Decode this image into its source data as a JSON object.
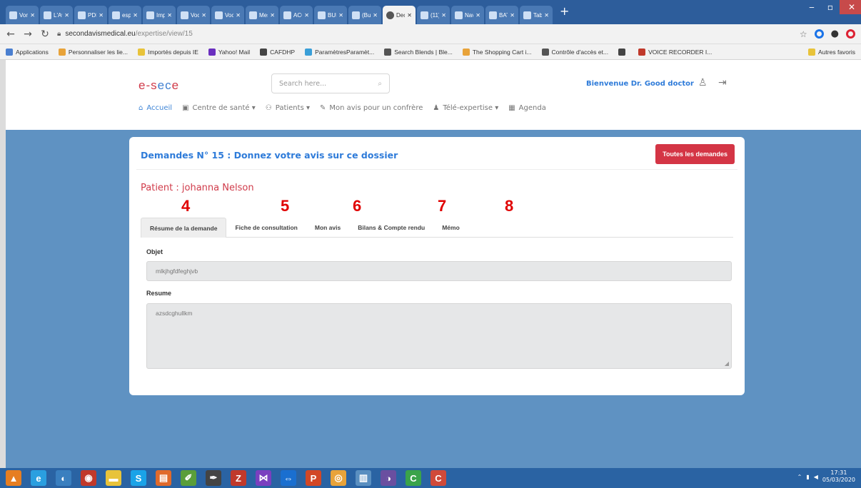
{
  "browser": {
    "tabs": [
      {
        "title": "Von",
        "active": false
      },
      {
        "title": "L'Av",
        "active": false
      },
      {
        "title": "PDF",
        "active": false
      },
      {
        "title": "esp",
        "active": false
      },
      {
        "title": "Imp",
        "active": false
      },
      {
        "title": "Voc",
        "active": false
      },
      {
        "title": "Voc",
        "active": false
      },
      {
        "title": "Mes",
        "active": false
      },
      {
        "title": "ACC",
        "active": false
      },
      {
        "title": "BUL",
        "active": false
      },
      {
        "title": "(Bu",
        "active": false
      },
      {
        "title": "Dec",
        "active": true
      },
      {
        "title": "(11)",
        "active": false
      },
      {
        "title": "Nav",
        "active": false
      },
      {
        "title": "BAT",
        "active": false
      },
      {
        "title": "Tabs",
        "active": false
      }
    ],
    "url_host": "secondavismedical.eu",
    "url_path": "/expertise/view/15",
    "bookmarks": [
      {
        "label": "Applications",
        "color": "#4a7fd0"
      },
      {
        "label": "Personnaliser les lie...",
        "color": "#e8a33a"
      },
      {
        "label": "Importés depuis IE",
        "color": "#e8c33a"
      },
      {
        "label": "Yahoo! Mail",
        "color": "#6a2fbf"
      },
      {
        "label": "CAFDHP",
        "color": "#444444"
      },
      {
        "label": "ParamètresParamèt...",
        "color": "#3a9fd8"
      },
      {
        "label": "Search Blends | Ble...",
        "color": "#555555"
      },
      {
        "label": "The Shopping Cart i...",
        "color": "#e8a33a"
      },
      {
        "label": "Contrôle d'accès et...",
        "color": "#555555"
      },
      {
        "label": "",
        "color": "#444444"
      },
      {
        "label": "VOICE RECORDER I...",
        "color": "#c0392b"
      }
    ],
    "other_bookmarks": "Autres favoris"
  },
  "site": {
    "logo_left": "e-s",
    "logo_mid": "ec",
    "logo_right": "e",
    "search_placeholder": "Search here...",
    "welcome": "Bienvenue Dr. Good doctor",
    "nav": [
      {
        "label": "Accueil",
        "icon": "home-icon",
        "glyph": "⌂",
        "active": true
      },
      {
        "label": "Centre de santé ▾",
        "icon": "building-icon",
        "glyph": "▣",
        "active": false
      },
      {
        "label": "Patients ▾",
        "icon": "users-icon",
        "glyph": "⚇",
        "active": false
      },
      {
        "label": "Mon avis pour un confrère",
        "icon": "edit-icon",
        "glyph": "✎",
        "active": false
      },
      {
        "label": "Télé-expertise ▾",
        "icon": "user-md-icon",
        "glyph": "♟",
        "active": false
      },
      {
        "label": "Agenda",
        "icon": "calendar-icon",
        "glyph": "▦",
        "active": false
      }
    ]
  },
  "card": {
    "title": "Demandes N° 15 : Donnez votre avis sur ce dossier",
    "all_button": "Toutes les demandes",
    "patient": "Patient : johanna Nelson",
    "step_numbers": [
      "4",
      "5",
      "6",
      "7",
      "8"
    ],
    "tabs": [
      {
        "label": "Résume de la demande",
        "active": true
      },
      {
        "label": "Fiche de consultation",
        "active": false
      },
      {
        "label": "Mon avis",
        "active": false
      },
      {
        "label": "Bilans & Compte rendu",
        "active": false
      },
      {
        "label": "Mémo",
        "active": false
      }
    ],
    "objet_label": "Objet",
    "objet_value": "mlkjhgfdfeghjvb",
    "resume_label": "Resume",
    "resume_value": "azsdcghullkm"
  },
  "taskbar": {
    "apps": [
      {
        "name": "vlc-icon",
        "glyph": "▲",
        "color": "#e67e22"
      },
      {
        "name": "internet-explorer-icon",
        "glyph": "e",
        "color": "#2a9fe0"
      },
      {
        "name": "app-icon",
        "glyph": "◐",
        "color": "#3a7fbf"
      },
      {
        "name": "power-icon",
        "glyph": "◉",
        "color": "#c0392b"
      },
      {
        "name": "folder-icon",
        "glyph": "▬",
        "color": "#e8c33a"
      },
      {
        "name": "skype-icon",
        "glyph": "S",
        "color": "#1aa3e8"
      },
      {
        "name": "office-icon",
        "glyph": "▤",
        "color": "#e06a2b"
      },
      {
        "name": "paint-icon",
        "glyph": "✐",
        "color": "#5a9e3a"
      },
      {
        "name": "pen-icon",
        "glyph": "✒",
        "color": "#444444"
      },
      {
        "name": "filezilla-icon",
        "glyph": "Z",
        "color": "#c0392b"
      },
      {
        "name": "visual-studio-icon",
        "glyph": "⋈",
        "color": "#7a3fbf"
      },
      {
        "name": "teamviewer-icon",
        "glyph": "⇔",
        "color": "#1a6fd0"
      },
      {
        "name": "powerpoint-icon",
        "glyph": "P",
        "color": "#d24726"
      },
      {
        "name": "chrome-icon",
        "glyph": "◎",
        "color": "#e8a33a"
      },
      {
        "name": "notepad-icon",
        "glyph": "▥",
        "color": "#5a8fc0"
      },
      {
        "name": "eclipse-icon",
        "glyph": "◑",
        "color": "#6a4fa0"
      },
      {
        "name": "camtasia-icon",
        "glyph": "C",
        "color": "#3aa34a"
      },
      {
        "name": "camtasia-recorder-icon",
        "glyph": "C",
        "color": "#d04a3a"
      }
    ],
    "time": "17:31",
    "date": "05/03/2020"
  }
}
